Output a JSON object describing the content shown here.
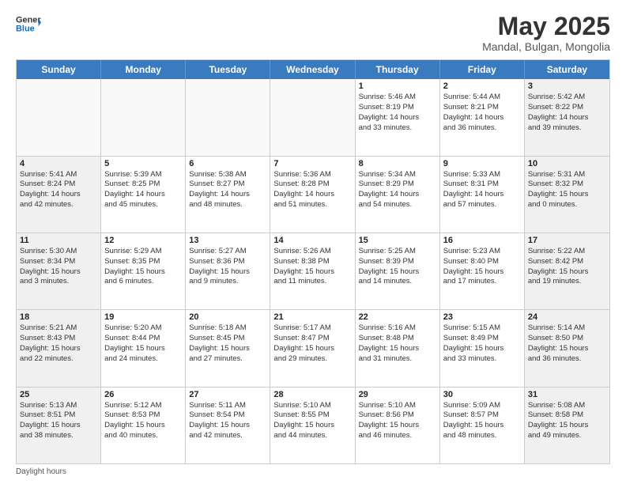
{
  "logo": {
    "general": "General",
    "blue": "Blue"
  },
  "title": "May 2025",
  "subtitle": "Mandal, Bulgan, Mongolia",
  "dayHeaders": [
    "Sunday",
    "Monday",
    "Tuesday",
    "Wednesday",
    "Thursday",
    "Friday",
    "Saturday"
  ],
  "footer": "Daylight hours",
  "weeks": [
    [
      {
        "day": "",
        "info": "",
        "empty": true
      },
      {
        "day": "",
        "info": "",
        "empty": true
      },
      {
        "day": "",
        "info": "",
        "empty": true
      },
      {
        "day": "",
        "info": "",
        "empty": true
      },
      {
        "day": "1",
        "info": "Sunrise: 5:46 AM\nSunset: 8:19 PM\nDaylight: 14 hours\nand 33 minutes."
      },
      {
        "day": "2",
        "info": "Sunrise: 5:44 AM\nSunset: 8:21 PM\nDaylight: 14 hours\nand 36 minutes."
      },
      {
        "day": "3",
        "info": "Sunrise: 5:42 AM\nSunset: 8:22 PM\nDaylight: 14 hours\nand 39 minutes."
      }
    ],
    [
      {
        "day": "4",
        "info": "Sunrise: 5:41 AM\nSunset: 8:24 PM\nDaylight: 14 hours\nand 42 minutes."
      },
      {
        "day": "5",
        "info": "Sunrise: 5:39 AM\nSunset: 8:25 PM\nDaylight: 14 hours\nand 45 minutes."
      },
      {
        "day": "6",
        "info": "Sunrise: 5:38 AM\nSunset: 8:27 PM\nDaylight: 14 hours\nand 48 minutes."
      },
      {
        "day": "7",
        "info": "Sunrise: 5:36 AM\nSunset: 8:28 PM\nDaylight: 14 hours\nand 51 minutes."
      },
      {
        "day": "8",
        "info": "Sunrise: 5:34 AM\nSunset: 8:29 PM\nDaylight: 14 hours\nand 54 minutes."
      },
      {
        "day": "9",
        "info": "Sunrise: 5:33 AM\nSunset: 8:31 PM\nDaylight: 14 hours\nand 57 minutes."
      },
      {
        "day": "10",
        "info": "Sunrise: 5:31 AM\nSunset: 8:32 PM\nDaylight: 15 hours\nand 0 minutes."
      }
    ],
    [
      {
        "day": "11",
        "info": "Sunrise: 5:30 AM\nSunset: 8:34 PM\nDaylight: 15 hours\nand 3 minutes."
      },
      {
        "day": "12",
        "info": "Sunrise: 5:29 AM\nSunset: 8:35 PM\nDaylight: 15 hours\nand 6 minutes."
      },
      {
        "day": "13",
        "info": "Sunrise: 5:27 AM\nSunset: 8:36 PM\nDaylight: 15 hours\nand 9 minutes."
      },
      {
        "day": "14",
        "info": "Sunrise: 5:26 AM\nSunset: 8:38 PM\nDaylight: 15 hours\nand 11 minutes."
      },
      {
        "day": "15",
        "info": "Sunrise: 5:25 AM\nSunset: 8:39 PM\nDaylight: 15 hours\nand 14 minutes."
      },
      {
        "day": "16",
        "info": "Sunrise: 5:23 AM\nSunset: 8:40 PM\nDaylight: 15 hours\nand 17 minutes."
      },
      {
        "day": "17",
        "info": "Sunrise: 5:22 AM\nSunset: 8:42 PM\nDaylight: 15 hours\nand 19 minutes."
      }
    ],
    [
      {
        "day": "18",
        "info": "Sunrise: 5:21 AM\nSunset: 8:43 PM\nDaylight: 15 hours\nand 22 minutes."
      },
      {
        "day": "19",
        "info": "Sunrise: 5:20 AM\nSunset: 8:44 PM\nDaylight: 15 hours\nand 24 minutes."
      },
      {
        "day": "20",
        "info": "Sunrise: 5:18 AM\nSunset: 8:45 PM\nDaylight: 15 hours\nand 27 minutes."
      },
      {
        "day": "21",
        "info": "Sunrise: 5:17 AM\nSunset: 8:47 PM\nDaylight: 15 hours\nand 29 minutes."
      },
      {
        "day": "22",
        "info": "Sunrise: 5:16 AM\nSunset: 8:48 PM\nDaylight: 15 hours\nand 31 minutes."
      },
      {
        "day": "23",
        "info": "Sunrise: 5:15 AM\nSunset: 8:49 PM\nDaylight: 15 hours\nand 33 minutes."
      },
      {
        "day": "24",
        "info": "Sunrise: 5:14 AM\nSunset: 8:50 PM\nDaylight: 15 hours\nand 36 minutes."
      }
    ],
    [
      {
        "day": "25",
        "info": "Sunrise: 5:13 AM\nSunset: 8:51 PM\nDaylight: 15 hours\nand 38 minutes."
      },
      {
        "day": "26",
        "info": "Sunrise: 5:12 AM\nSunset: 8:53 PM\nDaylight: 15 hours\nand 40 minutes."
      },
      {
        "day": "27",
        "info": "Sunrise: 5:11 AM\nSunset: 8:54 PM\nDaylight: 15 hours\nand 42 minutes."
      },
      {
        "day": "28",
        "info": "Sunrise: 5:10 AM\nSunset: 8:55 PM\nDaylight: 15 hours\nand 44 minutes."
      },
      {
        "day": "29",
        "info": "Sunrise: 5:10 AM\nSunset: 8:56 PM\nDaylight: 15 hours\nand 46 minutes."
      },
      {
        "day": "30",
        "info": "Sunrise: 5:09 AM\nSunset: 8:57 PM\nDaylight: 15 hours\nand 48 minutes."
      },
      {
        "day": "31",
        "info": "Sunrise: 5:08 AM\nSunset: 8:58 PM\nDaylight: 15 hours\nand 49 minutes."
      }
    ]
  ]
}
